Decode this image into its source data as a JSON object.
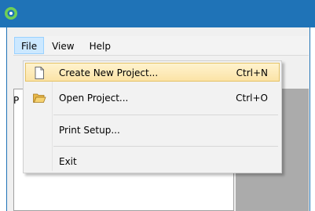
{
  "menubar": {
    "items": [
      {
        "label": "File",
        "active": true
      },
      {
        "label": "View",
        "active": false
      },
      {
        "label": "Help",
        "active": false
      }
    ]
  },
  "left_panel": {
    "header_fragment": "P"
  },
  "file_menu": {
    "items": [
      {
        "label": "Create New Project...",
        "shortcut": "Ctrl+N",
        "icon": "new-document-icon",
        "highlighted": true
      },
      {
        "label": "Open Project...",
        "shortcut": "Ctrl+O",
        "icon": "open-folder-icon",
        "highlighted": false
      },
      {
        "label": "Print Setup...",
        "shortcut": "",
        "icon": "",
        "highlighted": false
      },
      {
        "label": "Exit",
        "shortcut": "",
        "icon": "",
        "highlighted": false
      }
    ]
  },
  "colors": {
    "titlebar": "#1f73b7",
    "menu_active_bg": "#cce8ff",
    "menu_hover_bg": "#fbe3a6",
    "right_pane": "#ababab"
  }
}
